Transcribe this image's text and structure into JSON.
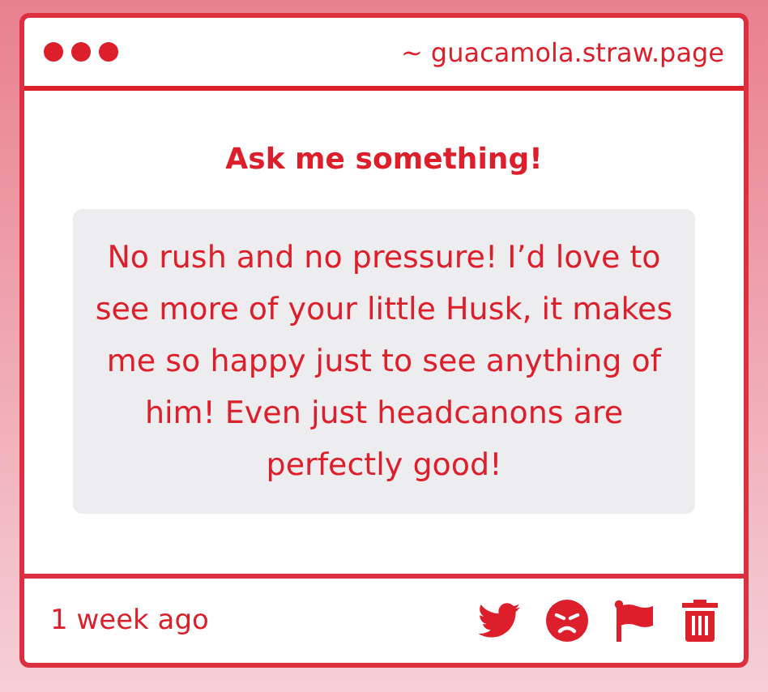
{
  "window": {
    "url": "~ guacamola.straw.page"
  },
  "question": {
    "title": "Ask me something!",
    "message": "No rush and no pressure! I’d love to see more of your little Husk, it makes me so happy just to see anything of him! Even just headcanons are perfectly good!"
  },
  "footer": {
    "time": "1 week ago",
    "actions": [
      {
        "kind": "twitter"
      },
      {
        "kind": "angry"
      },
      {
        "kind": "flag"
      },
      {
        "kind": "delete"
      }
    ]
  }
}
